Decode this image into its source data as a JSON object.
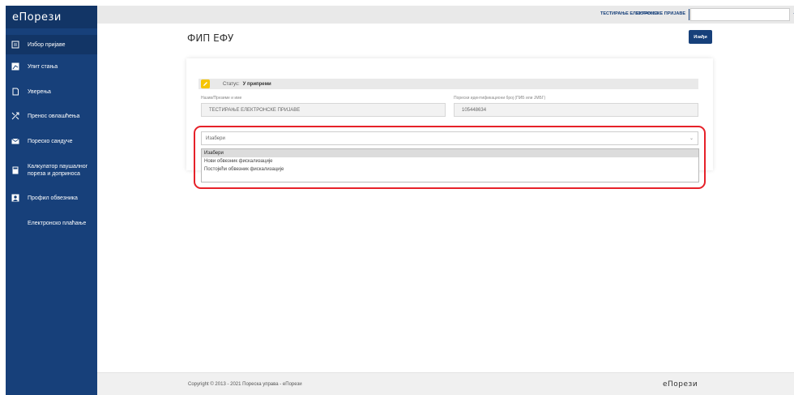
{
  "app": {
    "logo": "еПорези",
    "footer_logo": "еПорези"
  },
  "sidebar": {
    "items": [
      {
        "label": "Избор пријаве",
        "icon": "form-list-icon",
        "active": true
      },
      {
        "label": "Упит стања",
        "icon": "chart-icon",
        "active": false
      },
      {
        "label": "Уверења",
        "icon": "certificate-icon",
        "active": false
      },
      {
        "label": "Пренос овлашћења",
        "icon": "transfer-icon",
        "active": false
      },
      {
        "label": "Пореско сандуче",
        "icon": "mail-icon",
        "active": false
      },
      {
        "label": "Калкулатор паушалног",
        "label2": "пореза и доприноса",
        "icon": "calculator-icon",
        "active": false
      },
      {
        "label": "Профил обвезника",
        "icon": "profile-icon",
        "active": false
      },
      {
        "label": "Електронско плаћање",
        "icon": "",
        "active": false
      }
    ]
  },
  "header": {
    "pib": "105448634",
    "user_name": "ТЕСТИРАЊЕ ЕЛЕКТРОНСКЕ ПРИЈАВЕ"
  },
  "main": {
    "title": "ФИП ЕФУ",
    "exit_button": "Изађи",
    "status_label": "Статус:",
    "status_value": "У припреми",
    "name_label": "Назив/Презиме и име",
    "name_value": "ТЕСТИРАЊЕ ЕЛЕКТРОНСКЕ ПРИЈАВЕ",
    "pib_label": "Порески идентификациони број (ПИБ или ЈМБГ)",
    "pib_value": "105448634",
    "select_value": "Изабери",
    "options": [
      "Изабери",
      "Нови обвезник фискализације",
      "Постојећи обвезник фискализације"
    ]
  },
  "footer": {
    "copyright": "Copyright © 2013 - 2021 Пореска управа - еПорези"
  },
  "colors": {
    "sidebar": "#17407a",
    "sidebar_active": "#123566",
    "highlight": "#e62129",
    "status_icon": "#f6c500"
  }
}
